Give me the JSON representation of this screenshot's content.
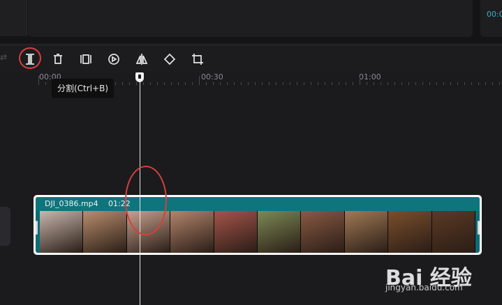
{
  "preview": {
    "timecode": "00:0"
  },
  "toolbar": {
    "tools": [
      {
        "name": "split",
        "icon": "split-icon"
      },
      {
        "name": "delete",
        "icon": "trash-icon"
      },
      {
        "name": "freeze",
        "icon": "freeze-frame-icon"
      },
      {
        "name": "reverse",
        "icon": "play-reverse-icon"
      },
      {
        "name": "mirror",
        "icon": "mirror-icon"
      },
      {
        "name": "rotate",
        "icon": "rotate-icon"
      },
      {
        "name": "crop",
        "icon": "crop-icon"
      }
    ]
  },
  "tooltip": {
    "text": "分割(Ctrl+B)"
  },
  "ruler": {
    "labels": [
      "00:00",
      "00:30",
      "01:00"
    ]
  },
  "clip": {
    "filename": "DJI_0386.mp4",
    "duration": "01:22",
    "thumb_colors": [
      "#c9b7ae",
      "#b98e6e",
      "#c7a18d",
      "#b3856c",
      "#a5544a",
      "#7c8a55",
      "#8a5a44",
      "#a17a55",
      "#7b4f2c",
      "#5b3a24"
    ]
  },
  "watermark": {
    "brand": "Bai 经验",
    "url": "jingyan.baidu.com"
  },
  "colors": {
    "accent": "#34b5c4",
    "clip": "#0e757d",
    "annotation": "#d6403c"
  }
}
